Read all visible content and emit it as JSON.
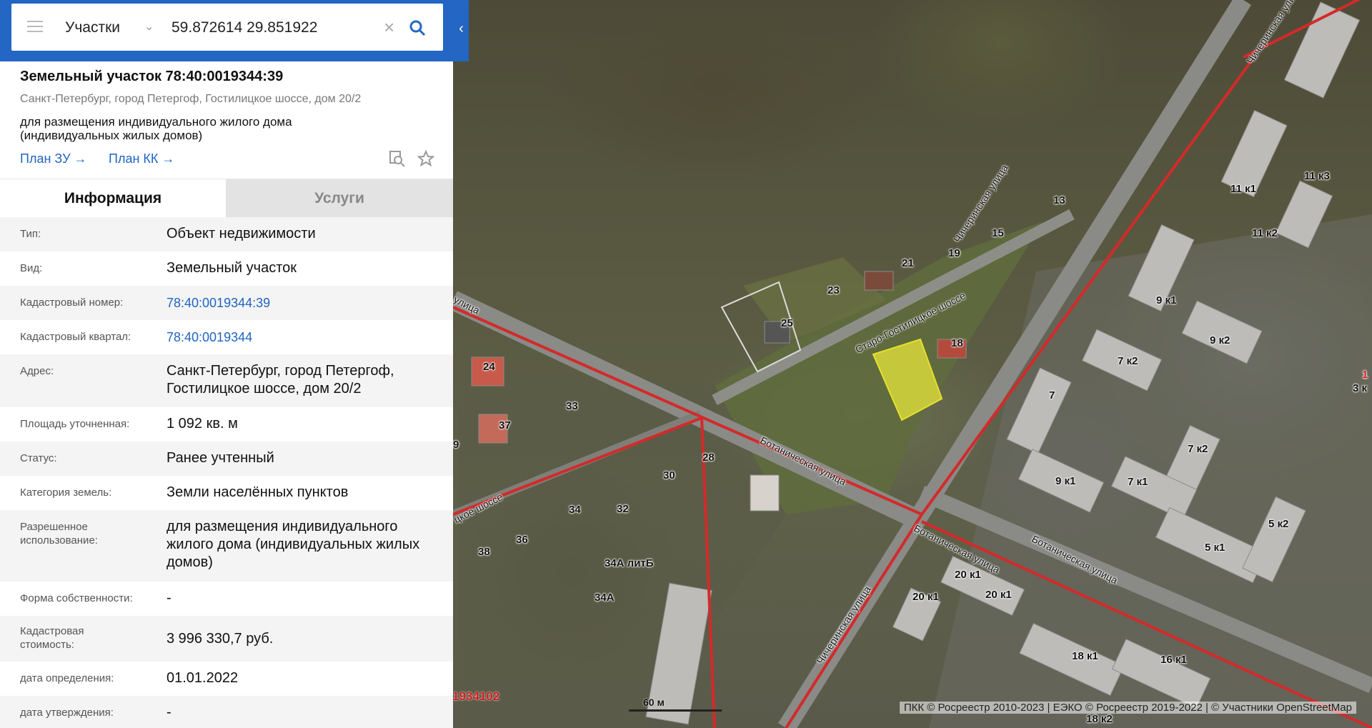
{
  "search": {
    "layer": "Участки",
    "query": "59.872614 29.851922"
  },
  "parcel": {
    "title": "Земельный участок 78:40:0019344:39",
    "address": "Санкт-Петербург, город Петергоф, Гостилицкое шоссе, дом 20/2",
    "use": "для размещения индивидуального жилого дома (индивидуальных жилых домов)",
    "plan_zu": "План ЗУ",
    "plan_kk": "План КК"
  },
  "tabs": {
    "info": "Информация",
    "services": "Услуги"
  },
  "rows": [
    {
      "label": "Тип:",
      "value": "Объект недвижимости"
    },
    {
      "label": "Вид:",
      "value": "Земельный участок"
    },
    {
      "label": "Кадастровый номер:",
      "value": "78:40:0019344:39"
    },
    {
      "label": "Кадастровый квартал:",
      "value": "78:40:0019344"
    },
    {
      "label": "Адрес:",
      "value": "Санкт-Петербург, город Петергоф, Гостилицкое шоссе, дом 20/2"
    },
    {
      "label": "Площадь уточненная:",
      "value": "1 092 кв. м"
    },
    {
      "label": "Статус:",
      "value": "Ранее учтенный"
    },
    {
      "label": "Категория земель:",
      "value": "Земли населённых пунктов"
    },
    {
      "label": "Разрешенное использование:",
      "value": "для размещения индивидуального жилого дома (индивидуальных жилых домов)"
    },
    {
      "label": "Форма собственности:",
      "value": "-"
    },
    {
      "label": "Кадастровая стоимость:",
      "value": "3 996 330,7 руб."
    },
    {
      "label": "дата определения:",
      "value": "01.01.2022"
    },
    {
      "label": "дата утверждения:",
      "value": "-"
    }
  ],
  "map": {
    "streets": {
      "chicherinskaya": "Чичеринская улица",
      "staro_gostilitskoe": "Старо-Гостилицкое шоссе",
      "botanicheskaya": "Ботаническая улица",
      "ulitsa_left": "улица",
      "shosse_left": "цкое шоссе"
    },
    "house_numbers": [
      "13",
      "15",
      "19",
      "21",
      "23",
      "25",
      "18",
      "24",
      "33",
      "37",
      "9",
      "28",
      "30",
      "34",
      "32",
      "36",
      "38",
      "34А литБ",
      "34А",
      "11 к1",
      "11 к3",
      "11 к2",
      "9 к1",
      "9 к2",
      "7 к2",
      "7",
      "7 к2",
      "9 к1",
      "7 к1",
      "5 к2",
      "5 к1",
      "20 к1",
      "20 к1",
      "20 к1",
      "18 к1",
      "16 к1",
      "18 к2",
      "3 к",
      "1"
    ],
    "cadastral_label": "1934102",
    "scale": "60 м",
    "attribution": "ПКК © Росреестр 2010-2023 | ЕЭКО © Росреестр 2019-2022 | © Участники OpenStreetMap",
    "colors": {
      "boundary": "#d32a2a",
      "parcel": "#f2ef3a",
      "accent": "#2366c4"
    }
  }
}
